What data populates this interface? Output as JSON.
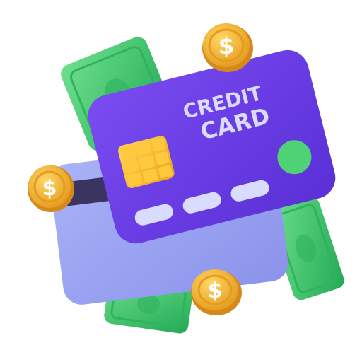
{
  "illustration": {
    "card_label_line1": "CREDIT",
    "card_label_line2": "CARD",
    "coin_symbol": "$",
    "colors": {
      "front_card": "#6a3fe6",
      "back_card": "#9aa4f4",
      "chip": "#f7b52a",
      "button": "#4fd276",
      "banknote": "#3ecb6e",
      "coin": "#f2b632",
      "card_text": "#d9dcff"
    }
  }
}
